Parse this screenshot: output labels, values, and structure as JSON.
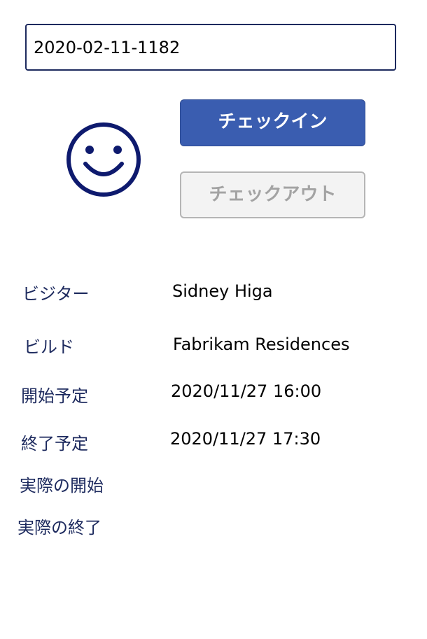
{
  "search": {
    "value": "2020-02-11-1182"
  },
  "status_icon": "smiley-face-icon",
  "buttons": {
    "checkin_label": "チェックイン",
    "checkout_label": "チェックアウト"
  },
  "details": {
    "visitor_label": "ビジター",
    "visitor_value": "Sidney Higa",
    "building_label": "ビルド",
    "building_value": "Fabrikam Residences",
    "scheduled_start_label": "開始予定",
    "scheduled_start_value": "2020/11/27 16:00",
    "scheduled_end_label": "終了予定",
    "scheduled_end_value": "2020/11/27 17:30",
    "actual_start_label": "実際の開始",
    "actual_end_label": "実際の終了"
  },
  "colors": {
    "primary": "#3a5db0",
    "label_text": "#1d2a5e",
    "disabled_text": "#a3a3a3",
    "disabled_bg": "#f3f3f3"
  }
}
